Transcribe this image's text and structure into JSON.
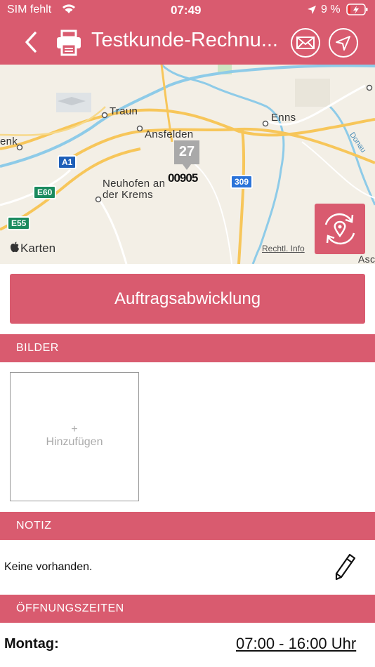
{
  "status": {
    "carrier": "SIM fehlt",
    "time": "07:49",
    "battery": "9 %"
  },
  "header": {
    "title": "Testkunde-Rechnu..."
  },
  "map": {
    "places": [
      "Traun",
      "Ansfelden",
      "Enns",
      "Neuhofen an",
      "der Krems",
      "enk",
      "Donau",
      "Asc"
    ],
    "shields": [
      "A1",
      "E60",
      "E55",
      "309"
    ],
    "cluster_count": "27",
    "cluster_label": "00905",
    "attribution_brand": "Karten",
    "legal": "Rechtl. Info"
  },
  "main_button": "Auftragsabwicklung",
  "sections": {
    "images": "BILDER",
    "note": "NOTIZ",
    "hours": "ÖFFNUNGSZEITEN"
  },
  "images": {
    "add_plus": "+",
    "add_label": "Hinzufügen"
  },
  "note": {
    "text": "Keine vorhanden."
  },
  "hours": {
    "day": "Montag:",
    "time": "07:00 - 16:00 Uhr"
  },
  "colors": {
    "accent": "#d95b6f",
    "map_bg": "#f3efe6",
    "road": "#f7c65a",
    "water": "#8ecbe8"
  },
  "icons": [
    "wifi-icon",
    "location-arrow-icon",
    "battery-icon",
    "back-chevron-icon",
    "printer-icon",
    "mail-icon",
    "navigate-icon",
    "refresh-location-icon",
    "pencil-icon"
  ]
}
